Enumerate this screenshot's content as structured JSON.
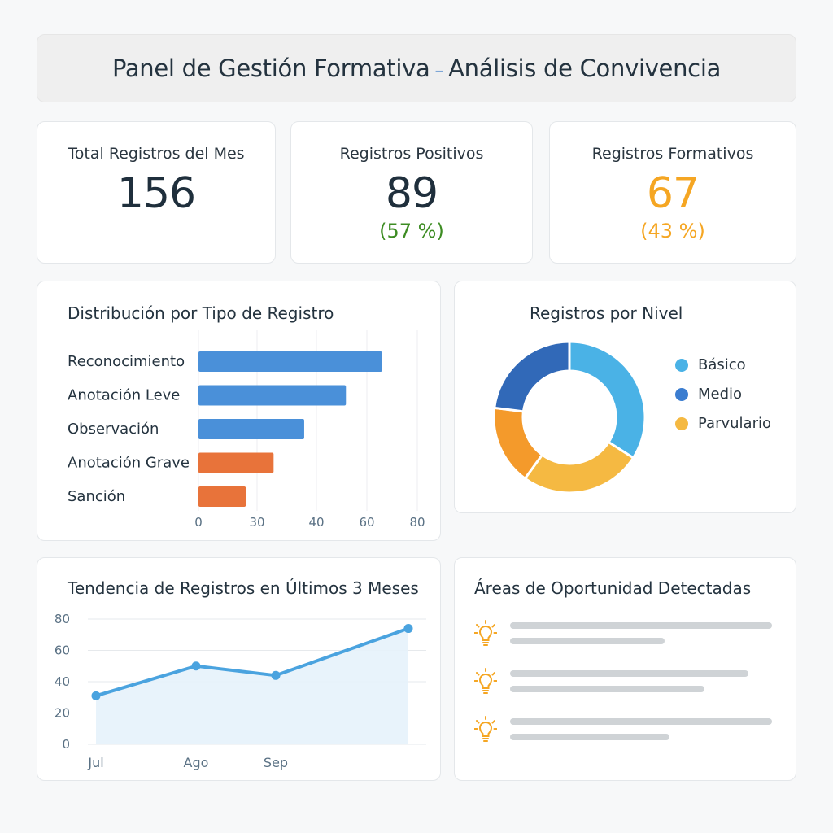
{
  "header": {
    "title_a": "Panel de Gestión Formativa",
    "dash": "–",
    "title_b": "Análisis de Convivencia"
  },
  "kpis": [
    {
      "label": "Total Registros del Mes",
      "value": "156",
      "pct": "",
      "color": "#1f2f3c"
    },
    {
      "label": "Registros Positivos",
      "value": "89",
      "pct": "(57 %)",
      "color": "#1f2f3c",
      "pct_color": "#3d8c23"
    },
    {
      "label": "Registros Formativos",
      "value": "67",
      "pct": "(43 %)",
      "color": "#f5a623",
      "pct_color": "#f5a623"
    }
  ],
  "bar_panel": {
    "title": "Distribución por Tipo de Registro"
  },
  "donut_panel": {
    "title": "Registros por Nivel"
  },
  "line_panel": {
    "title": "Tendencia de Registros en Últimos 3 Meses"
  },
  "opportunity_panel": {
    "title": "Áreas de Oportunidad Detectadas",
    "icon": "lightbulb-icon",
    "icon_color": "#f5a623",
    "item_count": 3
  },
  "chart_data": [
    {
      "type": "bar",
      "orientation": "horizontal",
      "categories": [
        "Reconocimiento",
        "Anotación Leve",
        "Observación",
        "Anotación Grave",
        "Sanción"
      ],
      "values": [
        66,
        53,
        38,
        27,
        17
      ],
      "colors": [
        "#4a90d9",
        "#4a90d9",
        "#4a90d9",
        "#e8733a",
        "#e8733a"
      ],
      "xticks": [
        0,
        30,
        40,
        60,
        80
      ],
      "grid": true
    },
    {
      "type": "pie",
      "donut": true,
      "categories": [
        "Básico",
        "Medio",
        "Parvulario"
      ],
      "legend_colors": [
        "#4ab2e6",
        "#3b7dd0",
        "#f5b942"
      ],
      "segments": [
        {
          "value": 34,
          "color": "#4ab2e6"
        },
        {
          "value": 26,
          "color": "#f5b942"
        },
        {
          "value": 17,
          "color": "#f49a2b"
        },
        {
          "value": 23,
          "color": "#3169b8"
        }
      ],
      "legend": "right"
    },
    {
      "type": "area",
      "x": [
        "Jul",
        "Ago",
        "Sep",
        ""
      ],
      "y": [
        31,
        50,
        44,
        74
      ],
      "ylim": [
        0,
        80
      ],
      "yticks": [
        0,
        20,
        40,
        60,
        80
      ],
      "grid": true,
      "color": "#4aa3df"
    }
  ]
}
